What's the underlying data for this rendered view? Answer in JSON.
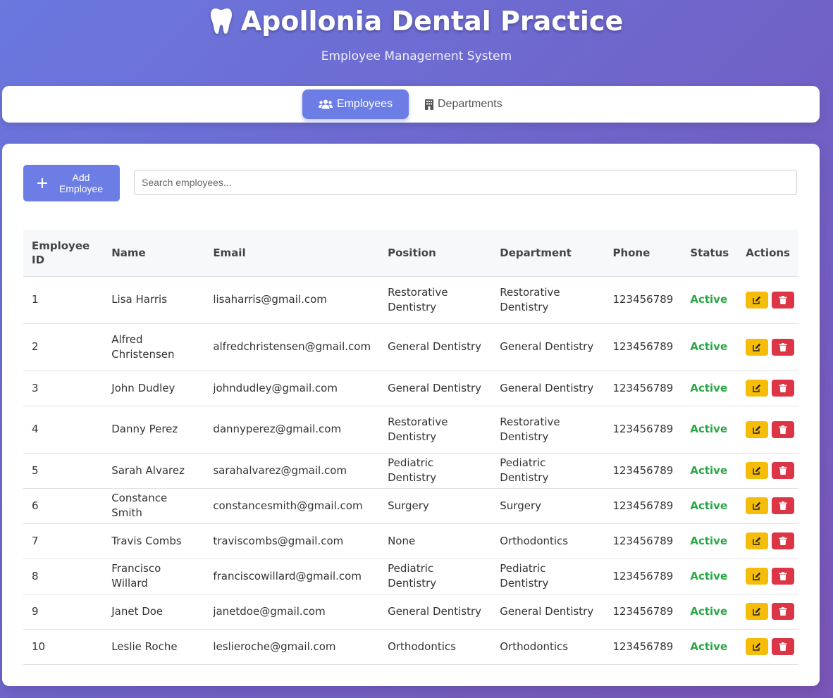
{
  "header": {
    "title": "Apollonia Dental Practice",
    "subtitle": "Employee Management System",
    "icon": "tooth-icon"
  },
  "nav": {
    "tabs": [
      {
        "label": "Employees",
        "icon": "users-icon",
        "active": true
      },
      {
        "label": "Departments",
        "icon": "building-icon",
        "active": false
      }
    ]
  },
  "toolbar": {
    "add_button_label": "Add Employee",
    "search_placeholder": "Search employees..."
  },
  "table": {
    "columns": [
      "Employee ID",
      "Name",
      "Email",
      "Position",
      "Department",
      "Phone",
      "Status",
      "Actions"
    ],
    "rows": [
      {
        "id": "1",
        "name": "Lisa Harris",
        "email": "lisaharris@gmail.com",
        "position": "Restorative Dentistry",
        "department": "Restorative Dentistry",
        "phone": "123456789",
        "status": "Active"
      },
      {
        "id": "2",
        "name": "Alfred Christensen",
        "email": "alfredchristensen@gmail.com",
        "position": "General Dentistry",
        "department": "General Dentistry",
        "phone": "123456789",
        "status": "Active"
      },
      {
        "id": "3",
        "name": "John Dudley",
        "email": "johndudley@gmail.com",
        "position": "General Dentistry",
        "department": "General Dentistry",
        "phone": "123456789",
        "status": "Active"
      },
      {
        "id": "4",
        "name": "Danny Perez",
        "email": "dannyperez@gmail.com",
        "position": "Restorative Dentistry",
        "department": "Restorative Dentistry",
        "phone": "123456789",
        "status": "Active"
      },
      {
        "id": "5",
        "name": "Sarah Alvarez",
        "email": "sarahalvarez@gmail.com",
        "position": "Pediatric Dentistry",
        "department": "Pediatric Dentistry",
        "phone": "123456789",
        "status": "Active"
      },
      {
        "id": "6",
        "name": "Constance Smith",
        "email": "constancesmith@gmail.com",
        "position": "Surgery",
        "department": "Surgery",
        "phone": "123456789",
        "status": "Active"
      },
      {
        "id": "7",
        "name": "Travis Combs",
        "email": "traviscombs@gmail.com",
        "position": "None",
        "department": "Orthodontics",
        "phone": "123456789",
        "status": "Active"
      },
      {
        "id": "8",
        "name": "Francisco Willard",
        "email": "franciscowillard@gmail.com",
        "position": "Pediatric Dentistry",
        "department": "Pediatric Dentistry",
        "phone": "123456789",
        "status": "Active"
      },
      {
        "id": "9",
        "name": "Janet Doe",
        "email": "janetdoe@gmail.com",
        "position": "General Dentistry",
        "department": "General Dentistry",
        "phone": "123456789",
        "status": "Active"
      },
      {
        "id": "10",
        "name": "Leslie Roche",
        "email": "leslieroche@gmail.com",
        "position": "Orthodontics",
        "department": "Orthodontics",
        "phone": "123456789",
        "status": "Active"
      }
    ],
    "action_icons": {
      "edit": "edit-icon",
      "delete": "trash-icon"
    }
  },
  "colors": {
    "accent": "#6c7ee6",
    "status_active": "#28a745",
    "edit_button": "#f5bd07",
    "delete_button": "#dc3545"
  }
}
